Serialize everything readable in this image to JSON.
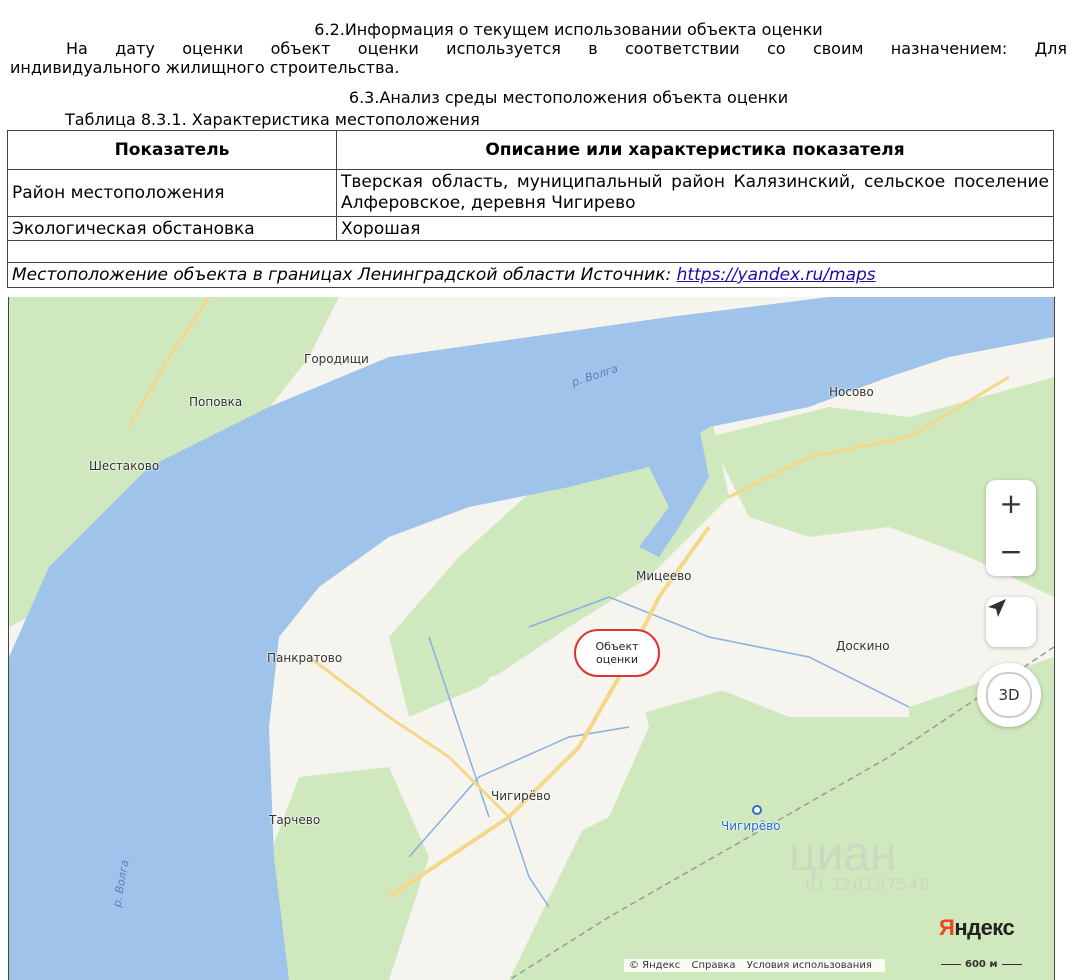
{
  "doc": {
    "heading_62": "6.2.Информация о текущем использовании объекта оценки",
    "para_line1": "На дату оценки объект оценки используется в соответствии со своим назначением: Для",
    "para_line2": "индивидуального жилищного строительства.",
    "heading_63": "6.3.Анализ среды местоположения объекта оценки",
    "table_caption": "Таблица 8.3.1. Характеристика местоположения"
  },
  "table": {
    "headers": [
      "Показатель",
      "Описание или характеристика показателя"
    ],
    "rows": [
      {
        "label": "Район местоположения",
        "value": "Тверская область, муниципальный район Калязинский, сельское поселение Алферовское, деревня Чигирево"
      },
      {
        "label": "Экологическая обстановка",
        "value": "Хорошая"
      }
    ],
    "map_caption": "Местоположение объекта в границах Ленинградской области Источник: ",
    "map_link": "https://yandex.ru/maps"
  },
  "map": {
    "places": {
      "gorodishchi": "Городищи",
      "popovka": "Поповка",
      "shestakovo": "Шестаково",
      "nosovo": "Носово",
      "mitseevo": "Мицеево",
      "pankratovo": "Панкратово",
      "doskino": "Доскино",
      "chigirevo_village": "Чигирёво",
      "tarchevo": "Тарчево",
      "chigirevo_station": "Чигирёво"
    },
    "river_top": "р. Волга",
    "river_left": "р. Волга",
    "marker": "Объект оценки",
    "zoom_in": "+",
    "zoom_out": "−",
    "btn_3d": "3D",
    "brand_first": "Я",
    "brand_rest": "ндекс",
    "copyright": "© Яндекс",
    "help": "Справка",
    "terms": "Условия использования",
    "scale": "600 м",
    "watermark": "циан",
    "watermark_id": "ID 320197548",
    "colors": {
      "water": "#9fc3ea",
      "forest": "#cfe8bd",
      "land": "#f6f4ef",
      "road": "#f5d78a",
      "marker": "#dd3333"
    }
  }
}
